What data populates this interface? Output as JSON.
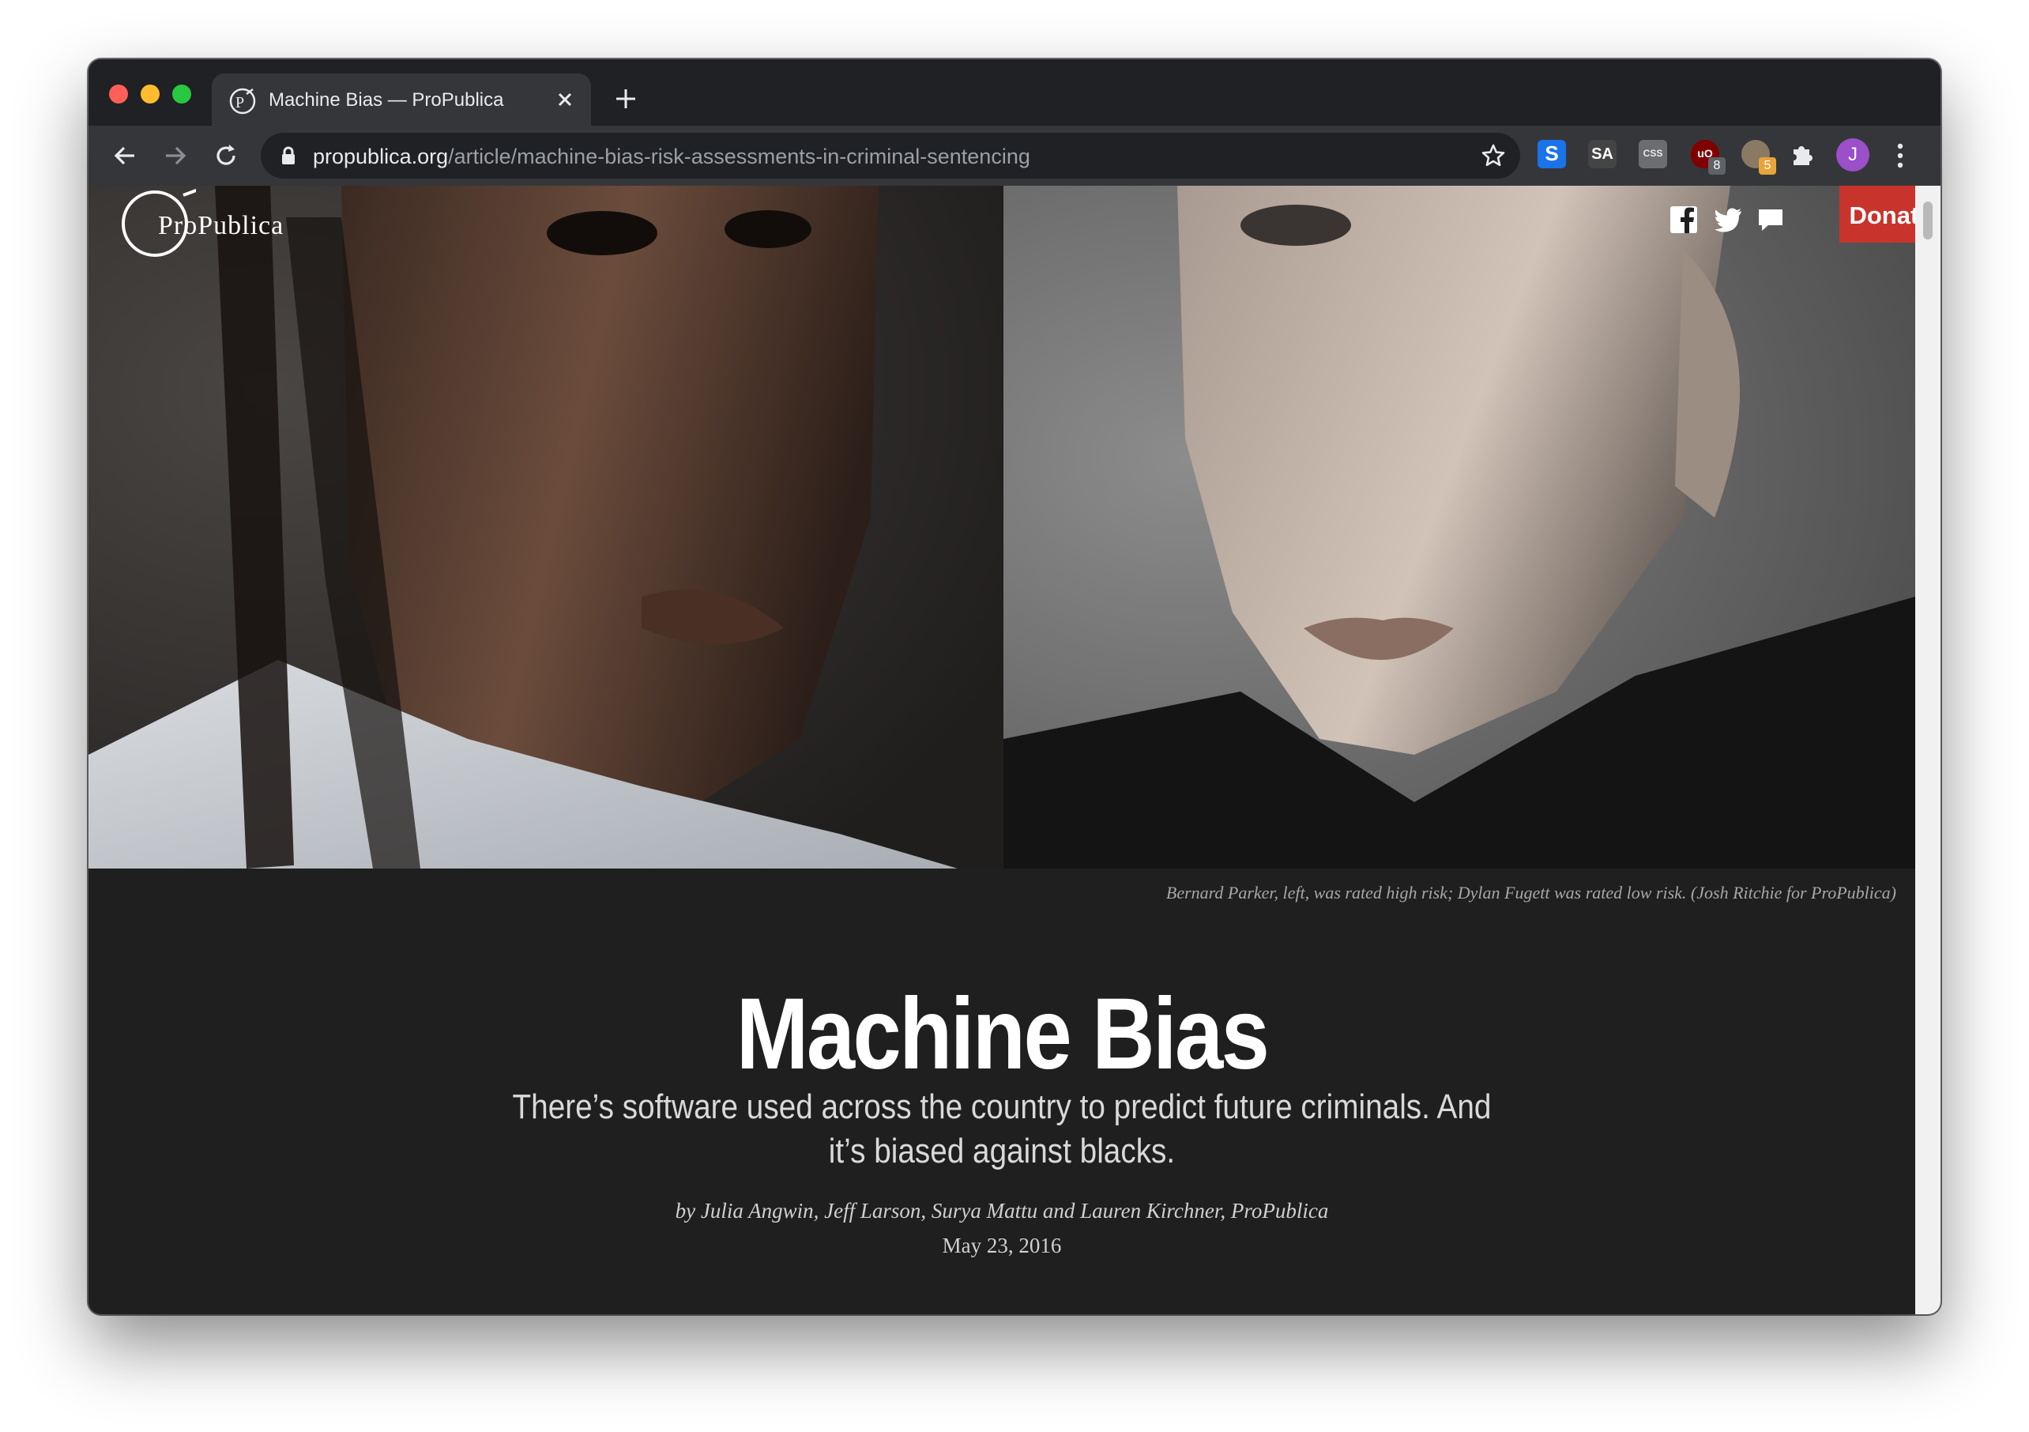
{
  "browser": {
    "tab_title": "Machine Bias — ProPublica",
    "url_host": "propublica.org",
    "url_path": "/article/machine-bias-risk-assessments-in-criminal-sentencing",
    "profile_initial": "J",
    "extensions": [
      {
        "name": "s-extension-icon",
        "label": "S"
      },
      {
        "name": "sa-extension-icon",
        "label": "SA"
      },
      {
        "name": "css-extension-icon",
        "label": "CSS"
      },
      {
        "name": "ublock-extension-icon",
        "label": "uO",
        "badge": "8"
      },
      {
        "name": "hamster-extension-icon",
        "label": "",
        "badge": "5"
      }
    ]
  },
  "site": {
    "logo": "ProPublica",
    "donate_label": "Donate"
  },
  "article": {
    "caption": "Bernard Parker, left, was rated high risk; Dylan Fugett was rated low risk. (Josh Ritchie for ProPublica)",
    "headline": "Machine Bias",
    "dek": "There’s software used across the country to predict future criminals. And it’s biased against blacks.",
    "byline": "by Julia Angwin, Jeff Larson, Surya Mattu and Lauren Kirchner, ProPublica",
    "date": "May 23, 2016"
  },
  "colors": {
    "page_background": "#1f1f20",
    "donate": "#c8342c",
    "chrome_dark": "#202124",
    "chrome_toolbar": "#35363a"
  }
}
